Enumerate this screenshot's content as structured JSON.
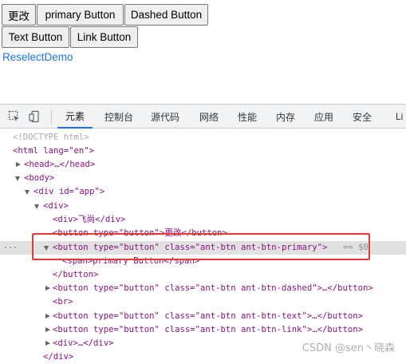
{
  "page": {
    "buttons": [
      "更改",
      "primary Button",
      "Dashed Button",
      "Text Button",
      "Link Button"
    ],
    "link_text": "ReselectDemo"
  },
  "devtools": {
    "tabs": [
      "元素",
      "控制台",
      "源代码",
      "网络",
      "性能",
      "内存",
      "应用",
      "安全",
      "Li"
    ],
    "active_tab": "元素",
    "tree": {
      "doctype": "<!DOCTYPE html>",
      "html_open": "<html lang=\"en\">",
      "head": "<head>…</head>",
      "body_open": "<body>",
      "app_div": "<div id=\"app\">",
      "div_open": "<div>",
      "feishang_div": "<div>飞尚</div>",
      "button_change": "<button type=\"button\">更改</button>",
      "primary_button": "<button type=\"button\" class=\"ant-btn ant-btn-primary\">",
      "selected_marker": "== $0",
      "span_primary": "<span>primary Button</span>",
      "button_close": "</button>",
      "dashed_button": "<button type=\"button\" class=\"ant-btn ant-btn-dashed\">…</button>",
      "br": "<br>",
      "text_button": "<button type=\"button\" class=\"ant-btn ant-btn-text\">…</button>",
      "link_button": "<button type=\"button\" class=\"ant-btn ant-btn-link\">…</button>",
      "div_collapsed": "<div>…</div>",
      "div_close": "</div>"
    }
  },
  "watermark": "CSDN @sen丶晓森",
  "colors": {
    "tag": "#881280",
    "attr_name": "#994500",
    "attr_value": "#1a1aa6",
    "link": "#1a73e8",
    "highlight_box": "#e53935"
  }
}
